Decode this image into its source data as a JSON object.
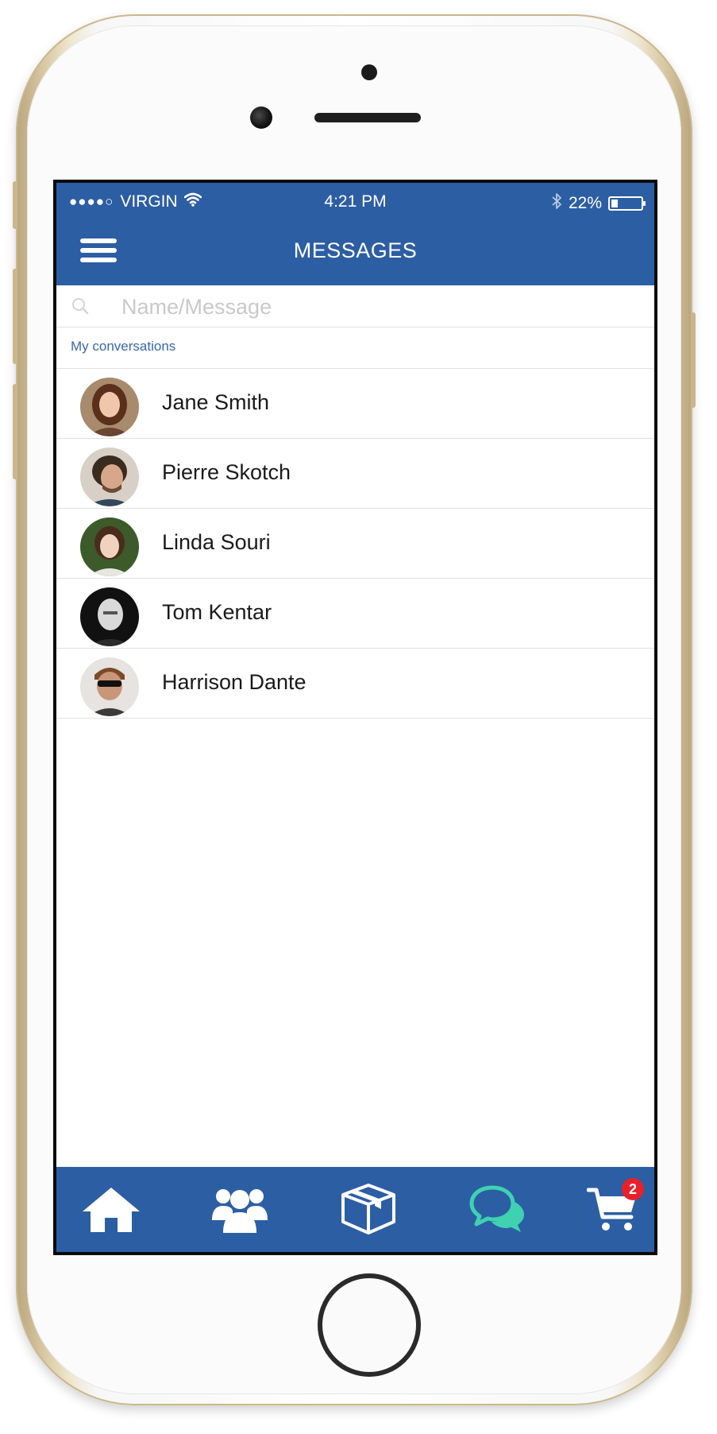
{
  "status_bar": {
    "signal": "●●●●○",
    "carrier": "VIRGIN",
    "time": "4:21 PM",
    "battery_percent": "22%",
    "battery_level": 0.22
  },
  "header": {
    "title": "MESSAGES"
  },
  "search": {
    "placeholder": "Name/Message",
    "value": ""
  },
  "section": {
    "label": "My conversations"
  },
  "conversations": [
    {
      "name": "Jane Smith"
    },
    {
      "name": "Pierre Skotch"
    },
    {
      "name": "Linda Souri"
    },
    {
      "name": "Tom Kentar"
    },
    {
      "name": "Harrison Dante"
    }
  ],
  "tabs": {
    "cart_badge": "2"
  },
  "colors": {
    "primary": "#2c5ea3",
    "active_tab": "#3fd1b0",
    "badge": "#e8202a",
    "label": "#3a67a8"
  }
}
